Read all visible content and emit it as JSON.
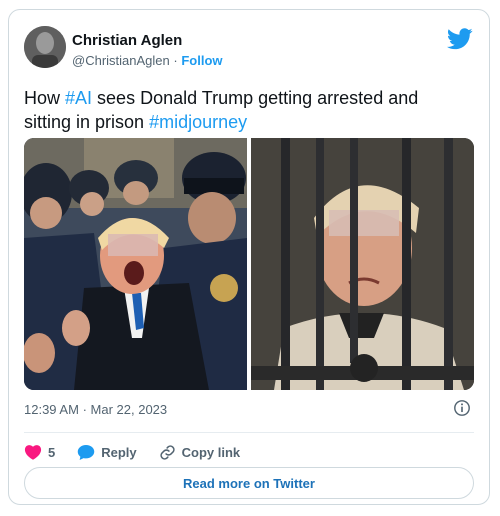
{
  "author": {
    "name": "Christian Aglen",
    "handle": "@ChristianAglen",
    "separator": "·",
    "follow_label": "Follow"
  },
  "tweet": {
    "text_before": "How ",
    "hashtag_ai": "#AI",
    "text_middle": " sees Donald Trump getting arrested and sitting in prison ",
    "hashtag_midjourney": "#midjourney"
  },
  "meta": {
    "time": "12:39 AM",
    "separator": "·",
    "date": "Mar 22, 2023"
  },
  "actions": {
    "like_count": "5",
    "reply_label": "Reply",
    "copy_link_label": "Copy link"
  },
  "read_more_label": "Read more on Twitter",
  "colors": {
    "accent": "#1d9bf0",
    "like": "#f91880",
    "secondary_text": "#536471"
  },
  "icons": [
    "twitter-bird-icon",
    "heart-icon",
    "reply-bubble-icon",
    "link-icon",
    "info-icon"
  ]
}
